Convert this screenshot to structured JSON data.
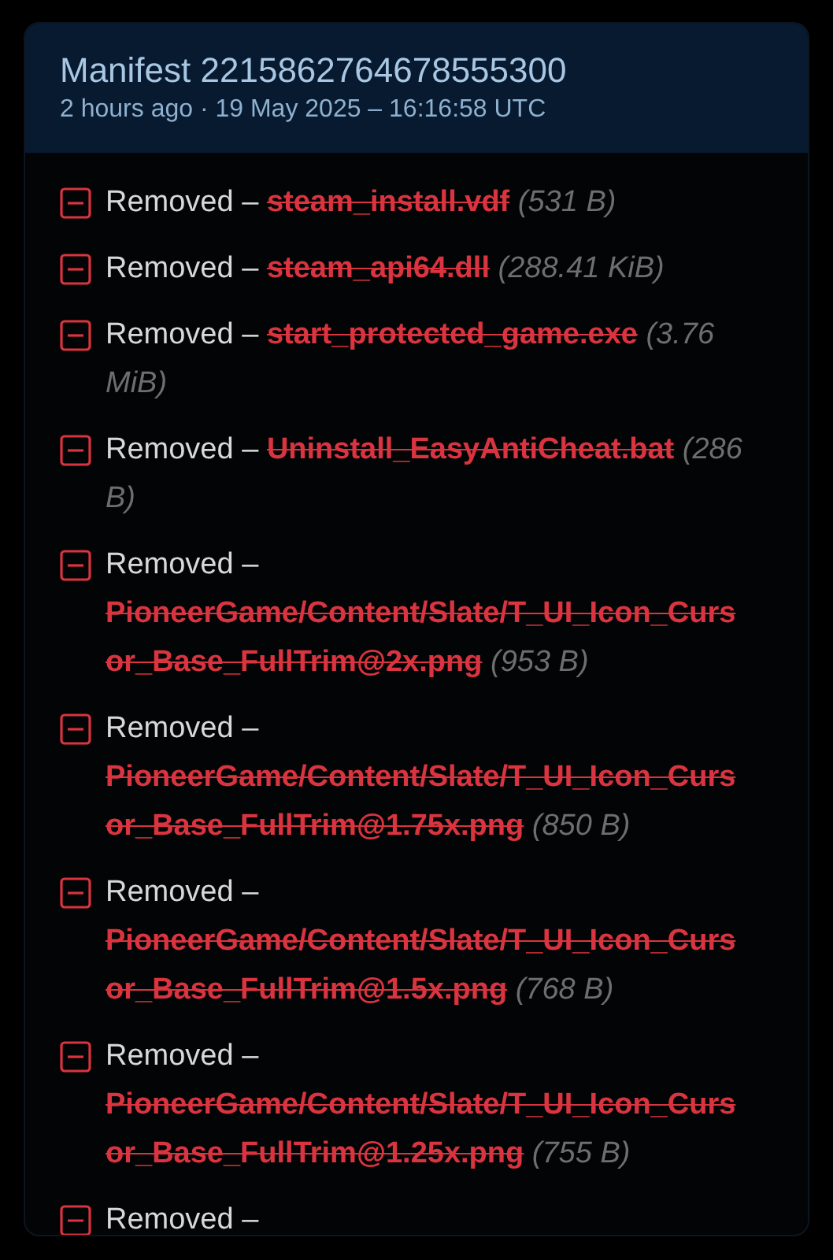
{
  "manifest": {
    "title": "Manifest 2215862764678555300",
    "subtitle": "2 hours ago · 19 May 2025 – 16:16:58 UTC"
  },
  "changes": [
    {
      "kind": "removed",
      "label": "Removed –",
      "file": "steam_install.vdf",
      "size": "(531 B)"
    },
    {
      "kind": "removed",
      "label": "Removed –",
      "file": "steam_api64.dll",
      "size": "(288.41 KiB)"
    },
    {
      "kind": "removed",
      "label": "Removed –",
      "file": "start_protected_game.exe",
      "size": "(3.76 MiB)"
    },
    {
      "kind": "removed",
      "label": "Removed –",
      "file": "Uninstall_EasyAntiCheat.bat",
      "size": "(286 B)"
    },
    {
      "kind": "removed",
      "label": "Removed –",
      "file": "PioneerGame/Content/Slate/T_UI_Icon_Cursor_Base_FullTrim@2x.png",
      "size": "(953 B)"
    },
    {
      "kind": "removed",
      "label": "Removed –",
      "file": "PioneerGame/Content/Slate/T_UI_Icon_Cursor_Base_FullTrim@1.75x.png",
      "size": "(850 B)"
    },
    {
      "kind": "removed",
      "label": "Removed –",
      "file": "PioneerGame/Content/Slate/T_UI_Icon_Cursor_Base_FullTrim@1.5x.png",
      "size": "(768 B)"
    },
    {
      "kind": "removed",
      "label": "Removed –",
      "file": "PioneerGame/Content/Slate/T_UI_Icon_Cursor_Base_FullTrim@1.25x.png",
      "size": "(755 B)"
    },
    {
      "kind": "removed",
      "label": "Removed –"
    }
  ]
}
